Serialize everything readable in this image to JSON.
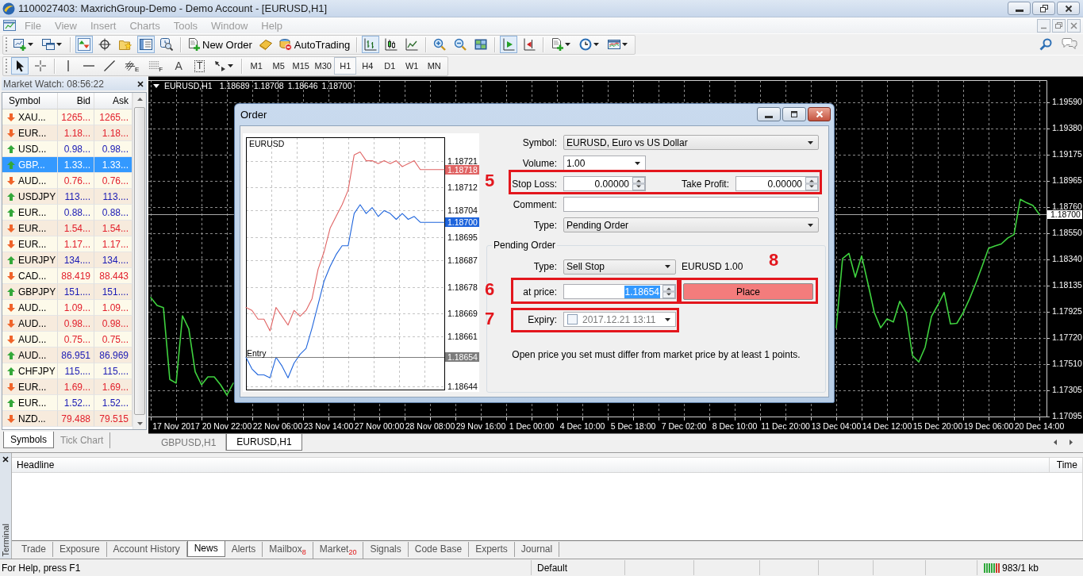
{
  "window": {
    "title": "1100027403: MaxrichGroup-Demo - Demo Account - [EURUSD,H1]"
  },
  "menu": [
    {
      "label": "File",
      "disabled": true
    },
    {
      "label": "View",
      "disabled": true
    },
    {
      "label": "Insert",
      "disabled": true
    },
    {
      "label": "Charts",
      "disabled": true
    },
    {
      "label": "Tools",
      "disabled": true
    },
    {
      "label": "Window",
      "disabled": true
    },
    {
      "label": "Help",
      "disabled": true
    }
  ],
  "toolbar": {
    "items": [
      {
        "pressed": false
      },
      {
        "pressed": false
      },
      {
        "pressed": true
      },
      {
        "pressed": false
      },
      {
        "pressed": false
      },
      {
        "pressed": true
      },
      {
        "pressed": false
      },
      {
        "label": "New Order",
        "pressed": false
      },
      {
        "pressed": false
      },
      {
        "label": "AutoTrading",
        "pressed": false
      },
      {
        "pressed": true
      },
      {
        "pressed": false
      },
      {
        "pressed": false
      },
      {
        "pressed": false
      },
      {
        "pressed": false
      },
      {
        "pressed": false
      },
      {
        "pressed": true
      },
      {
        "pressed": false
      },
      {
        "pressed": false
      },
      {
        "pressed": false
      },
      {
        "pressed": false
      }
    ]
  },
  "drawing_toolbar": {
    "tools": [
      {
        "pressed": true
      },
      {
        "pressed": false
      },
      {
        "pressed": false
      },
      {
        "pressed": false
      },
      {
        "pressed": false
      },
      {
        "glyph": "E",
        "pressed": false
      },
      {
        "glyph": "F",
        "pressed": false
      },
      {
        "glyph": "A",
        "pressed": false
      },
      {
        "glyph": "T",
        "pressed": false
      },
      {
        "pressed": false
      }
    ],
    "timeframes": [
      {
        "label": "M1",
        "selected": false
      },
      {
        "label": "M5",
        "selected": false
      },
      {
        "label": "M15",
        "selected": false
      },
      {
        "label": "M30",
        "selected": false
      },
      {
        "label": "H1",
        "selected": true
      },
      {
        "label": "H4",
        "selected": false
      },
      {
        "label": "D1",
        "selected": false
      },
      {
        "label": "W1",
        "selected": false
      },
      {
        "label": "MN",
        "selected": false
      }
    ]
  },
  "market_watch": {
    "title": "Market Watch: 08:56:22",
    "columns": [
      "Symbol",
      "Bid",
      "Ask"
    ],
    "rows": [
      {
        "symbol": "XAU...",
        "bid": "1265...",
        "ask": "1265...",
        "rising": false,
        "selected": false
      },
      {
        "symbol": "EUR...",
        "bid": "1.18...",
        "ask": "1.18...",
        "rising": false,
        "selected": false
      },
      {
        "symbol": "USD...",
        "bid": "0.98...",
        "ask": "0.98...",
        "rising": true,
        "selected": false
      },
      {
        "symbol": "GBP...",
        "bid": "1.33...",
        "ask": "1.33...",
        "rising": true,
        "selected": true
      },
      {
        "symbol": "AUD...",
        "bid": "0.76...",
        "ask": "0.76...",
        "rising": false,
        "selected": false
      },
      {
        "symbol": "USDJPY",
        "bid": "113....",
        "ask": "113....",
        "rising": true,
        "selected": false
      },
      {
        "symbol": "EUR...",
        "bid": "0.88...",
        "ask": "0.88...",
        "rising": true,
        "selected": false
      },
      {
        "symbol": "EUR...",
        "bid": "1.54...",
        "ask": "1.54...",
        "rising": false,
        "selected": false
      },
      {
        "symbol": "EUR...",
        "bid": "1.17...",
        "ask": "1.17...",
        "rising": false,
        "selected": false
      },
      {
        "symbol": "EURJPY",
        "bid": "134....",
        "ask": "134....",
        "rising": true,
        "selected": false
      },
      {
        "symbol": "CAD...",
        "bid": "88.419",
        "ask": "88.443",
        "rising": false,
        "selected": false
      },
      {
        "symbol": "GBPJPY",
        "bid": "151....",
        "ask": "151....",
        "rising": true,
        "selected": false
      },
      {
        "symbol": "AUD...",
        "bid": "1.09...",
        "ask": "1.09...",
        "rising": false,
        "selected": false
      },
      {
        "symbol": "AUD...",
        "bid": "0.98...",
        "ask": "0.98...",
        "rising": false,
        "selected": false
      },
      {
        "symbol": "AUD...",
        "bid": "0.75...",
        "ask": "0.75...",
        "rising": false,
        "selected": false
      },
      {
        "symbol": "AUD...",
        "bid": "86.951",
        "ask": "86.969",
        "rising": true,
        "selected": false
      },
      {
        "symbol": "CHFJPY",
        "bid": "115....",
        "ask": "115....",
        "rising": true,
        "selected": false
      },
      {
        "symbol": "EUR...",
        "bid": "1.69...",
        "ask": "1.69...",
        "rising": false,
        "selected": false
      },
      {
        "symbol": "EUR...",
        "bid": "1.52...",
        "ask": "1.52...",
        "rising": true,
        "selected": false
      },
      {
        "symbol": "NZD...",
        "bid": "79.488",
        "ask": "79.515",
        "rising": false,
        "selected": false
      }
    ],
    "tabs": [
      {
        "label": "Symbols",
        "selected": true
      },
      {
        "label": "Tick Chart",
        "selected": false
      }
    ]
  },
  "chart": {
    "title": "EURUSD,H1",
    "quote": [
      "1.18689",
      "1.18708",
      "1.18646",
      "1.18700"
    ],
    "chart_data": {
      "type": "line",
      "categories": [
        null,
        null,
        null,
        null,
        "17 Nov 2017",
        null,
        null,
        null,
        null,
        null,
        null,
        null,
        "20 Nov 22:00",
        null,
        null,
        null,
        null,
        null,
        null,
        null,
        "22 Nov 06:00",
        null,
        null,
        null,
        null,
        null,
        null,
        null,
        "23 Nov 14:00",
        null,
        null,
        null,
        null,
        null,
        null,
        null,
        "27 Nov 00:00",
        null,
        null,
        null,
        null,
        null,
        null,
        null,
        "28 Nov 08:00",
        null,
        null,
        null,
        null,
        null,
        null,
        null,
        "29 Nov 16:00",
        null,
        null,
        null,
        null,
        null,
        null,
        null,
        "1 Dec 00:00",
        null,
        null,
        null,
        null,
        null,
        null,
        null,
        "4 Dec 10:00",
        null,
        null,
        null,
        null,
        null,
        null,
        null,
        "5 Dec 18:00",
        null,
        null,
        null,
        null,
        null,
        null,
        null,
        "7 Dec 02:00",
        null,
        null,
        null,
        null,
        null,
        null,
        null,
        "8 Dec 10:00",
        null,
        null,
        null,
        null,
        null,
        null,
        null,
        "11 Dec 20:00",
        null,
        null,
        null,
        null,
        null,
        null,
        null,
        "13 Dec 04:00",
        null,
        null,
        null,
        null,
        null,
        null,
        null,
        "14 Dec 12:00",
        null,
        null,
        null,
        null,
        null,
        null,
        null,
        "15 Dec 20:00",
        null,
        null,
        null,
        null,
        null,
        null,
        null,
        "19 Dec 06:00",
        null,
        null,
        null,
        null,
        null,
        null,
        null,
        "20 Dec 14:00"
      ],
      "series": [
        {
          "values": [
            1.1804,
            1.17977,
            1.1796,
            1.1739,
            1.1736,
            1.17895,
            1.1779,
            1.1745,
            1.17347,
            1.1741,
            1.1741,
            1.17347,
            1.17265,
            1.1736,
            null,
            null,
            null,
            null,
            null,
            null,
            null,
            null,
            null,
            null,
            null,
            null,
            null,
            null,
            null,
            null,
            null,
            null,
            null,
            null,
            null,
            null,
            null,
            null,
            null,
            null,
            null,
            null,
            null,
            null,
            null,
            null,
            null,
            null,
            null,
            null,
            null,
            null,
            null,
            null,
            null,
            null,
            null,
            null,
            null,
            null,
            null,
            null,
            null,
            null,
            null,
            null,
            null,
            null,
            null,
            null,
            null,
            null,
            null,
            null,
            null,
            null,
            null,
            null,
            null,
            null,
            null,
            null,
            null,
            null,
            null,
            null,
            null,
            null,
            null,
            null,
            null,
            null,
            null,
            null,
            null,
            null,
            null,
            null,
            null,
            null,
            null,
            null,
            null,
            null,
            null,
            null,
            null,
            null,
            1.178,
            1.1835,
            1.1839,
            1.18202,
            1.1837,
            1.1815,
            1.1792,
            1.178,
            1.1787,
            1.17846,
            1.1801,
            1.1792,
            1.1758,
            1.17528,
            1.17645,
            1.1789,
            1.1798,
            1.1808,
            1.1783,
            1.17835,
            1.1792,
            1.1803,
            1.18155,
            1.1829,
            1.1843,
            1.1845,
            1.18465,
            1.18512,
            1.1854,
            1.1882,
            1.18792,
            1.1877,
            1.187
          ]
        }
      ],
      "ylim": [
        1.17095,
        1.19766
      ],
      "yticks": [
        {
          "value": 1.1959,
          "label": "1.19590"
        },
        {
          "value": 1.1938,
          "label": "1.19380"
        },
        {
          "value": 1.19175,
          "label": "1.19175"
        },
        {
          "value": 1.18965,
          "label": "1.18965"
        },
        {
          "value": 1.1876,
          "label": "1.18760"
        },
        {
          "value": 1.1855,
          "label": "1.18550"
        },
        {
          "value": 1.1834,
          "label": "1.18340"
        },
        {
          "value": 1.18135,
          "label": "1.18135"
        },
        {
          "value": 1.17925,
          "label": "1.17925"
        },
        {
          "value": 1.1772,
          "label": "1.17720"
        },
        {
          "value": 1.1751,
          "label": "1.17510"
        },
        {
          "value": 1.17305,
          "label": "1.17305"
        },
        {
          "value": 1.17095,
          "label": "1.17095"
        }
      ],
      "grid": true,
      "ref_lines": [
        {
          "axis": "y",
          "value": 1.187
        }
      ],
      "annotations": [
        "1.18700"
      ]
    }
  },
  "chart_tabs": [
    {
      "label": "GBPUSD,H1",
      "selected": false
    },
    {
      "label": "EURUSD,H1",
      "selected": true
    }
  ],
  "order_dialog": {
    "title": "Order",
    "preview": {
      "chart_data": {
        "type": "line",
        "title": "EURUSD",
        "categories": [
          null,
          null,
          null,
          null,
          null,
          null,
          null,
          null,
          null,
          null,
          null,
          null,
          null,
          null,
          null,
          null,
          null,
          null,
          null,
          null,
          null,
          null,
          null,
          null,
          null,
          null,
          null,
          null,
          null,
          null,
          null,
          null,
          null,
          null
        ],
        "series": [
          {
            "color": "#e06464",
            "values": [
              1.18671,
              1.1867,
              1.18667,
              1.18667,
              1.18663,
              1.18671,
              1.18668,
              1.18665,
              1.1867,
              1.18668,
              1.1867,
              1.18674,
              1.18684,
              1.1869,
              1.18698,
              1.18702,
              1.18706,
              1.18711,
              1.18723,
              1.18724,
              1.18721,
              1.18721,
              1.1872,
              1.18721,
              1.1872,
              1.18721,
              1.18719,
              1.1872,
              1.18721,
              1.18718,
              1.18718,
              1.18718,
              1.18718,
              1.18718
            ]
          },
          {
            "color": "#1e64dc",
            "values": [
              1.18654,
              1.1865,
              1.18648,
              1.18648,
              1.18647,
              1.18654,
              1.18651,
              1.18647,
              1.18652,
              1.18655,
              1.18657,
              1.18664,
              1.18672,
              1.1868,
              1.18685,
              1.18689,
              1.18692,
              1.18692,
              1.18703,
              1.18706,
              1.18703,
              1.18705,
              1.18702,
              1.18704,
              1.18703,
              1.18701,
              1.18703,
              1.18701,
              1.18702,
              1.187,
              1.187,
              1.187,
              1.187,
              1.187
            ]
          }
        ],
        "ylim": [
          1.18643,
          1.18729
        ],
        "yticks": [
          {
            "value": 1.18721,
            "label": "1.18721"
          },
          {
            "value": 1.18712,
            "label": "1.18712"
          },
          {
            "value": 1.18704,
            "label": "1.18704"
          },
          {
            "value": 1.18695,
            "label": "1.18695"
          },
          {
            "value": 1.18687,
            "label": "1.18687"
          },
          {
            "value": 1.18678,
            "label": "1.18678"
          },
          {
            "value": 1.18669,
            "label": "1.18669"
          },
          {
            "value": 1.18661,
            "label": "1.18661"
          },
          {
            "value": 1.18644,
            "label": "1.18644"
          }
        ],
        "grid": true,
        "ref_lines": [
          {
            "axis": "y",
            "value": 1.18654,
            "label": "Entry"
          }
        ],
        "annotations": [
          "1.18718",
          "1.18700",
          "1.18654"
        ]
      }
    },
    "form": {
      "symbol": {
        "label": "Symbol:",
        "value": "EURUSD, Euro vs US Dollar"
      },
      "volume": {
        "label": "Volume:",
        "value": "1.00"
      },
      "stop_loss": {
        "label": "Stop Loss:",
        "value": "0.00000"
      },
      "take_profit": {
        "label": "Take Profit:",
        "value": "0.00000"
      },
      "comment": {
        "label": "Comment:"
      },
      "type": {
        "label": "Type:",
        "value": "Pending Order"
      }
    },
    "pending": {
      "title": "Pending Order",
      "type": {
        "label": "Type:",
        "value": "Sell Stop"
      },
      "summary": "EURUSD 1.00",
      "price": {
        "label": "at price:",
        "value": "1.18654",
        "text_selected": true
      },
      "place_button": "Place",
      "expiry": {
        "label": "Expiry:",
        "value": "2017.12.21 13:11",
        "checked": false,
        "disabled": true
      },
      "note": "Open price you set must differ from market price by at least 1 points."
    },
    "callouts": [
      {
        "label": "5"
      },
      {
        "label": "6"
      },
      {
        "label": "7"
      },
      {
        "label": "8"
      }
    ]
  },
  "terminal": {
    "title": "Terminal",
    "columns": [
      "Headline",
      "Time"
    ],
    "tabs": [
      {
        "label": "Trade",
        "selected": false
      },
      {
        "label": "Exposure",
        "selected": false
      },
      {
        "label": "Account History",
        "selected": false
      },
      {
        "label": "News",
        "selected": true
      },
      {
        "label": "Alerts",
        "selected": false
      },
      {
        "label": "Mailbox$_{8}$",
        "selected": false
      },
      {
        "label": "Market$_{20}$",
        "selected": false
      },
      {
        "label": "Signals",
        "selected": false
      },
      {
        "label": "Code Base",
        "selected": false
      },
      {
        "label": "Experts",
        "selected": false
      },
      {
        "label": "Journal",
        "selected": false
      }
    ]
  },
  "status_bar": {
    "help": "For Help, press F1",
    "profile": "Default",
    "traffic": "983/1 kb"
  }
}
